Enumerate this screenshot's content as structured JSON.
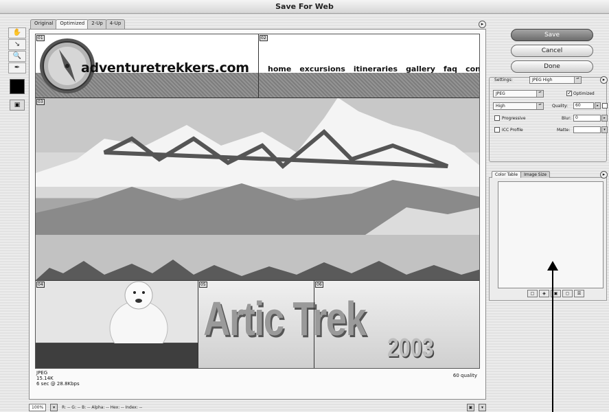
{
  "window": {
    "title": "Save For Web"
  },
  "tools": [
    "hand-icon",
    "slice-select-icon",
    "zoom-icon",
    "eyedropper-icon"
  ],
  "tabs": [
    "Original",
    "Optimized",
    "2-Up",
    "4-Up"
  ],
  "preview": {
    "brand": "adventuretrekkers.com",
    "nav": [
      "home",
      "excursions",
      "itineraries",
      "gallery",
      "faq",
      "contact"
    ],
    "title": "Artic Trek",
    "year": "2003"
  },
  "image_info": {
    "format": "JPEG",
    "size": "15.14K",
    "download": "6 sec @ 28.8Kbps",
    "quality": "60 quality"
  },
  "statusbar": {
    "zoom": "100%",
    "readout": "R: --  G: --  B: --  Alpha: --  Hex: --  Index: --"
  },
  "buttons": {
    "save": "Save",
    "cancel": "Cancel",
    "done": "Done"
  },
  "settings": {
    "label": "Settings:",
    "preset": "JPEG High",
    "format": "JPEG",
    "optimized_label": "Optimized",
    "optimized": true,
    "compression": "High",
    "quality_label": "Quality:",
    "quality": "60",
    "progressive_label": "Progressive",
    "blur_label": "Blur:",
    "blur": "0",
    "icc_label": "ICC Profile",
    "matte_label": "Matte:",
    "matte": ""
  },
  "color_table": {
    "tabs": [
      "Color Table",
      "Image Size"
    ]
  }
}
